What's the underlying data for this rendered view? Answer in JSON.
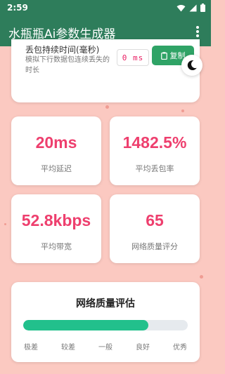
{
  "status_bar": {
    "time": "2:59"
  },
  "app_bar": {
    "title": "水瓶瓶Ai参数生成器"
  },
  "top_card": {
    "title": "丢包持续时间(毫秒)",
    "description": "模拟下行数据包连续丢失的时长",
    "value_display": "0 ms",
    "copy_label": "复制"
  },
  "stats": [
    {
      "value": "20ms",
      "label": "平均延迟"
    },
    {
      "value": "1482.5%",
      "label": "平均丢包率"
    },
    {
      "value": "52.8kbps",
      "label": "平均带宽"
    },
    {
      "value": "65",
      "label": "网络质量评分"
    }
  ],
  "evaluation": {
    "title": "网络质量评估",
    "progress_fraction": 0.76,
    "scale_labels": [
      "极差",
      "较差",
      "一般",
      "良好",
      "优秀"
    ]
  },
  "colors": {
    "app_bar": "#2e7d5b",
    "background": "#fbc9c1",
    "accent_value": "#ee3f6e",
    "progress": "#22c08c",
    "copy_button": "#2fa366"
  }
}
